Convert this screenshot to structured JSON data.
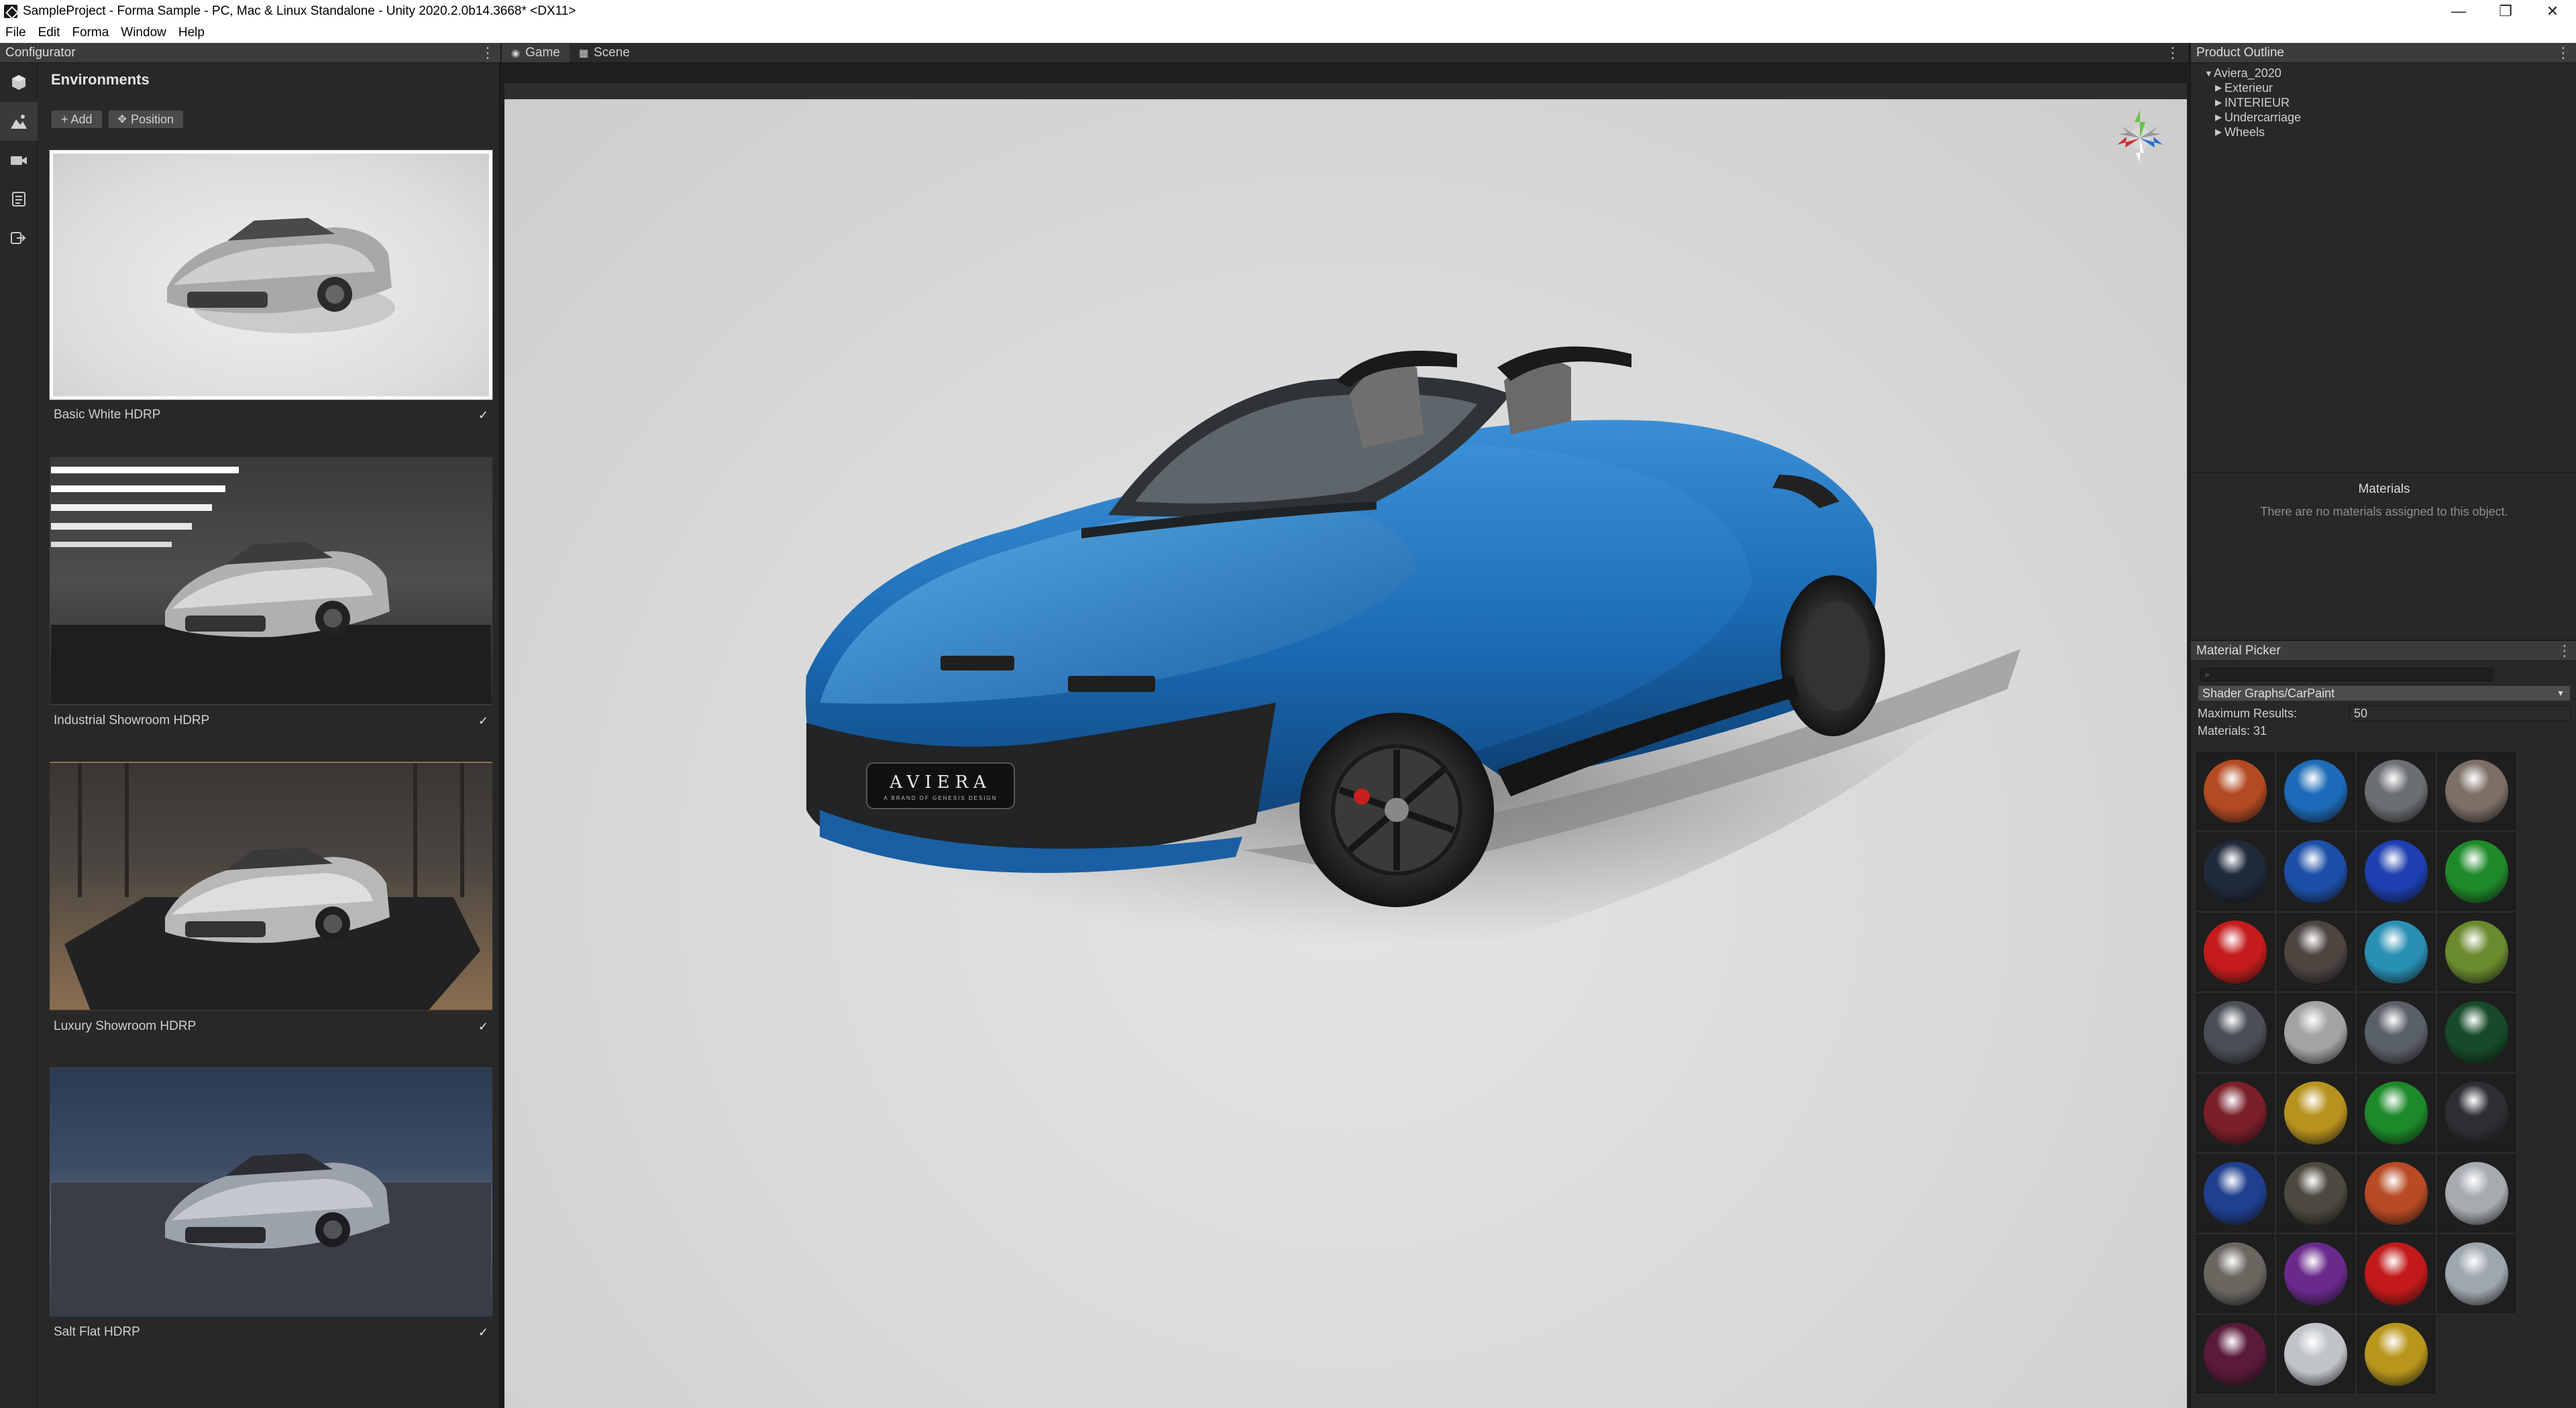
{
  "window": {
    "title": "SampleProject - Forma Sample - PC, Mac & Linux Standalone - Unity 2020.2.0b14.3668* <DX11>",
    "controls": [
      "—",
      "❐",
      "✕"
    ]
  },
  "menu": [
    "File",
    "Edit",
    "Forma",
    "Window",
    "Help"
  ],
  "configurator": {
    "panel_title": "Configurator",
    "section_title": "Environments",
    "add_label": "+ Add",
    "position_label": "Position",
    "environments": [
      {
        "label": "Basic White HDRP",
        "checked": "✓",
        "selected": true
      },
      {
        "label": "Industrial Showroom HDRP",
        "checked": "✓",
        "selected": false
      },
      {
        "label": "Luxury Showroom HDRP",
        "checked": "✓",
        "selected": false
      },
      {
        "label": "Salt Flat HDRP",
        "checked": "✓",
        "selected": false
      }
    ]
  },
  "viewport": {
    "tabs": [
      "Game",
      "Scene"
    ],
    "brand_badge": "AVIERA",
    "brand_sub": "A BRAND OF GENESIS DESIGN"
  },
  "outline": {
    "panel_title": "Product Outline",
    "root": "Aviera_2020",
    "children": [
      "Exterieur",
      "INTERIEUR",
      "Undercarriage",
      "Wheels"
    ]
  },
  "materials": {
    "title": "Materials",
    "empty_text": "There are no materials assigned to this object."
  },
  "picker": {
    "panel_title": "Material Picker",
    "search_placeholder": "",
    "shader": "Shader Graphs/CarPaint",
    "max_results_label": "Maximum Results:",
    "max_results_value": "50",
    "count_text": "Materials: 31",
    "swatches": [
      "#b44a22",
      "#1d6bb8",
      "#6b6e72",
      "#7c6f66",
      "#1f2a3a",
      "#1d4fa8",
      "#1e3fb0",
      "#1f8a2a",
      "#c41c1c",
      "#4d4540",
      "#2a8fb4",
      "#6a8a2e",
      "#4a4e55",
      "#a3a3a3",
      "#5a6068",
      "#164a28",
      "#7a1f28",
      "#b8921e",
      "#1c8a2a",
      "#2d2f33",
      "#1f3f8f",
      "#4c4a3e",
      "#b84a24",
      "#a6abb0",
      "#6a6760",
      "#6a2a8c",
      "#c21a1a",
      "#9ea6ae",
      "#5a1a3a",
      "#c0c4c8",
      "#b8961c"
    ]
  }
}
